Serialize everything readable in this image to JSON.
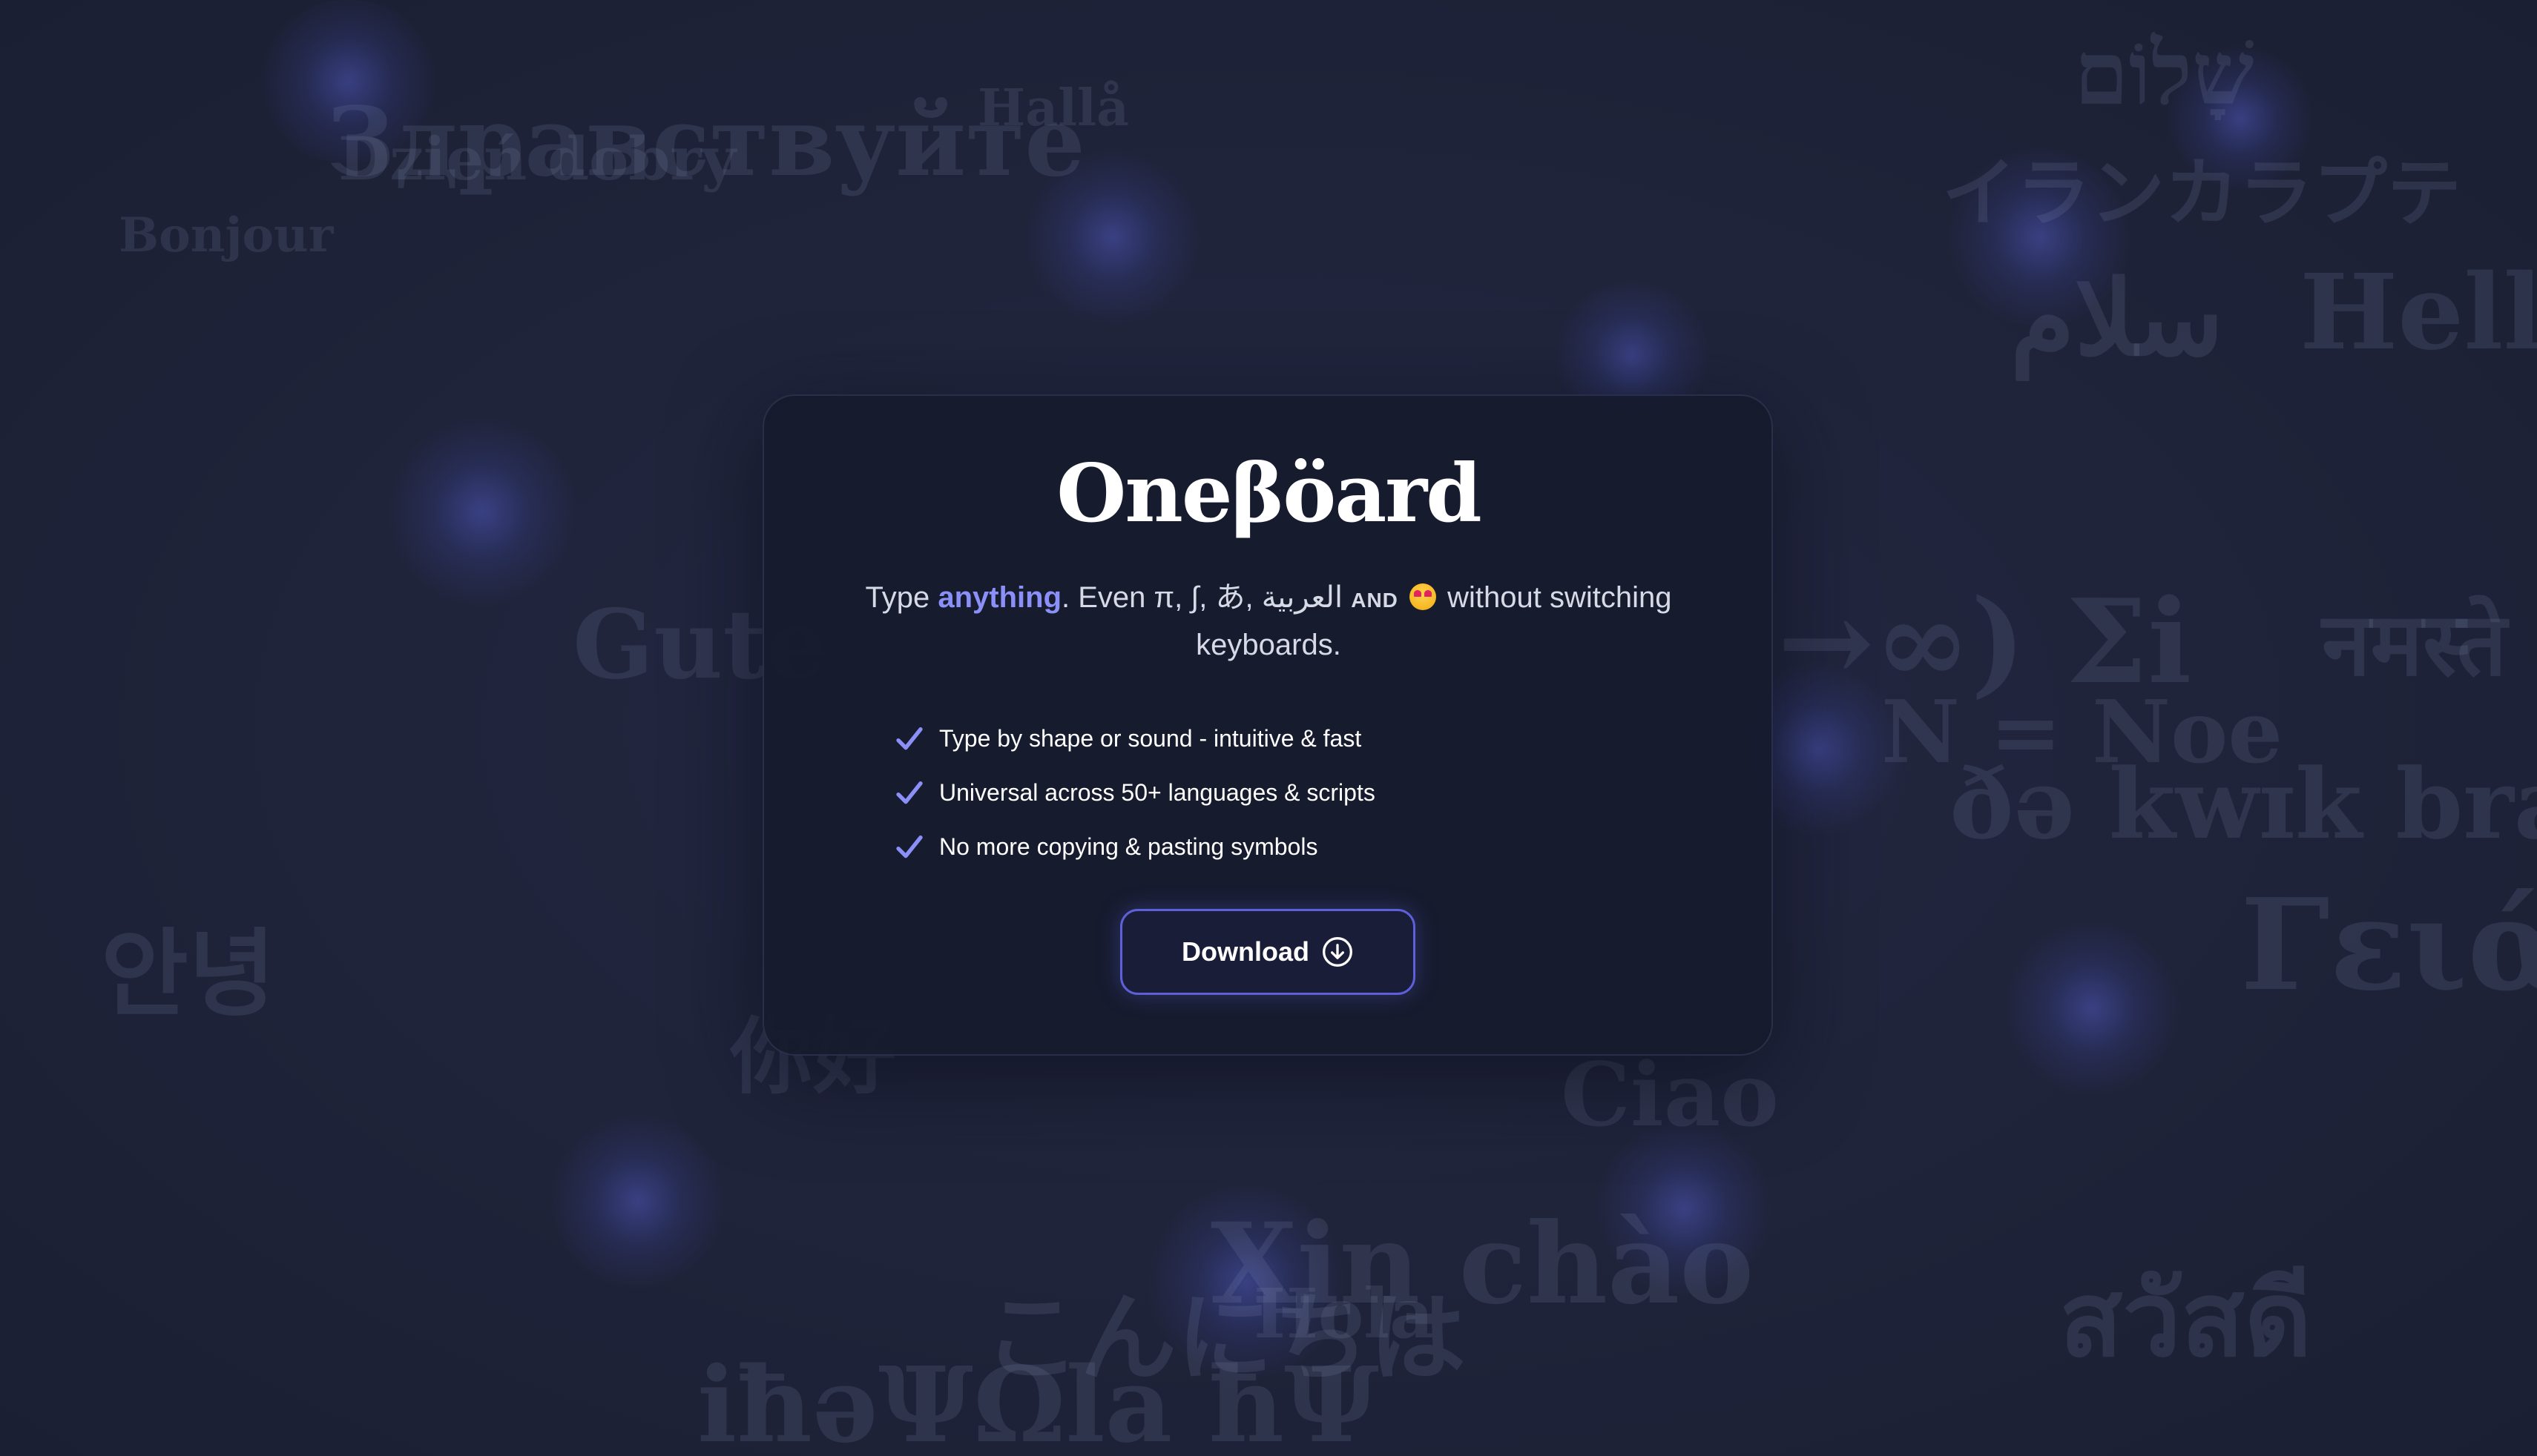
{
  "app": {
    "logo": "Oneβöard"
  },
  "background_words": {
    "w0": "Здравствуйте",
    "w1": "Dzień dobry",
    "w2": "Hallå",
    "w3": "Bonjour",
    "w4": "שָׁלוֹם",
    "w5": "イランカラプテ",
    "w6": "سلام",
    "w7": "Hello",
    "w8": "Gute",
    "w9": "→∞) Σi",
    "w10": "N = Noe",
    "w11": "नमस्ते",
    "w12": "ðə kwɪk braʊ",
    "w13": "Γειά",
    "w14": "안녕",
    "w15": "你好",
    "w16": "Ciao",
    "w17": "Xin chào",
    "w18": "こんにちは",
    "w19": "Hola",
    "w20": "iħəΨΩla ħΨ",
    "w21": "สวัสดี"
  },
  "hero": {
    "tagline": {
      "prefix": "Type ",
      "highlight": "anything",
      "middle": ". Even π, ∫, あ, العربية ",
      "and": "AND",
      "suffix": " without switching keyboards."
    },
    "features": [
      "Type by shape or sound - intuitive & fast",
      "Universal across 50+ languages & scripts",
      "No more copying & pasting symbols"
    ],
    "download_label": "Download"
  },
  "colors": {
    "accent": "#8b8ff8",
    "button_border": "#5d60d8",
    "card_background": "#161a2c",
    "page_background": "#1e2238"
  },
  "icons": {
    "check": "checkmark-icon",
    "download": "download-circle-arrow-icon",
    "emoji": "heart-eyes-emoji-icon"
  }
}
